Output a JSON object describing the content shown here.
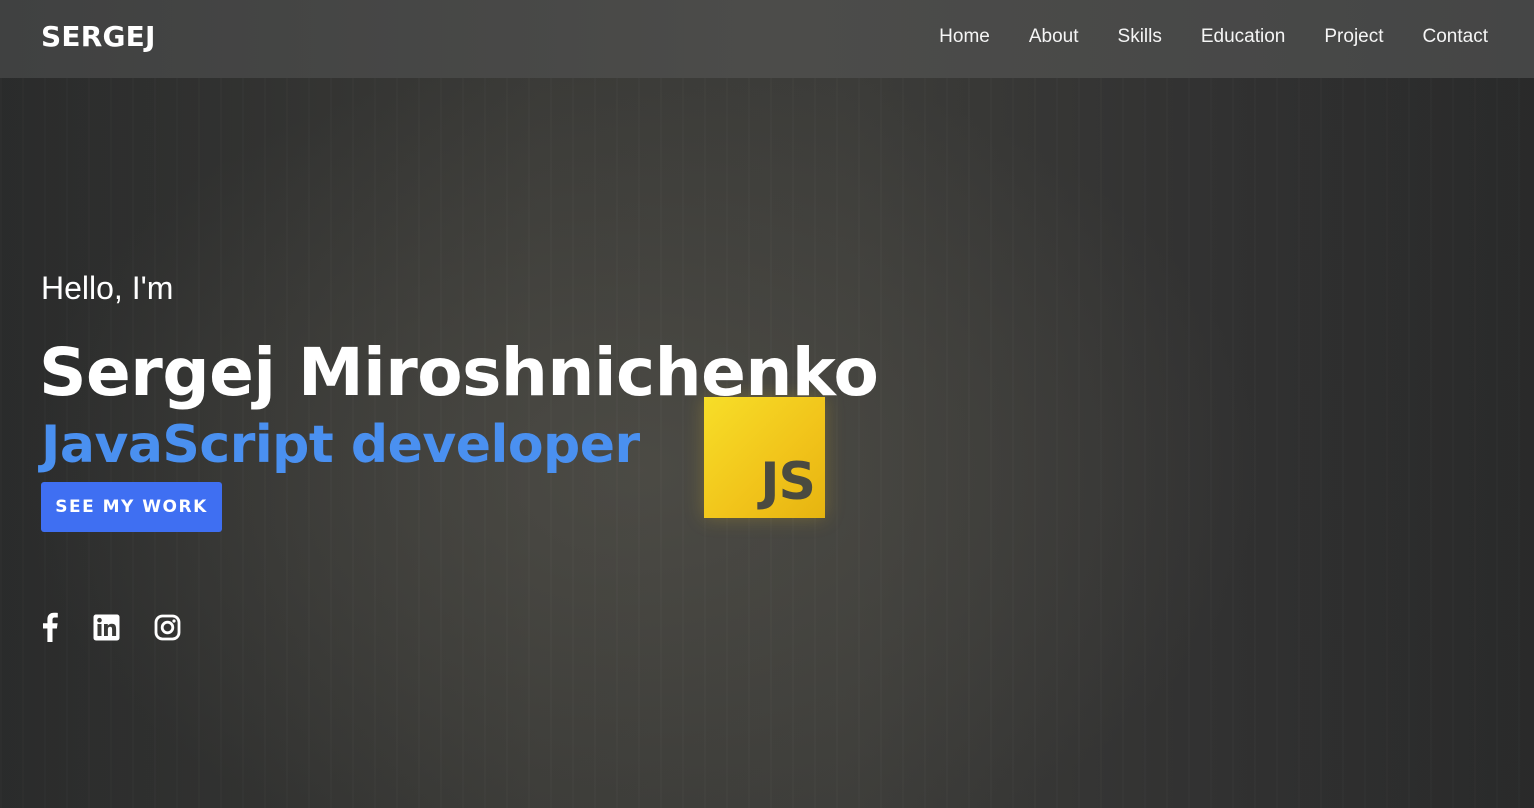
{
  "header": {
    "brand": "SERGEJ",
    "nav": [
      "Home",
      "About",
      "Skills",
      "Education",
      "Project",
      "Contact"
    ]
  },
  "hero": {
    "greeting": "Hello, I'm",
    "name": "Sergej Miroshnichenko",
    "role": "JavaScript developer",
    "cta_label": "SEE MY WORK",
    "badge_text": "JS"
  },
  "socials": [
    "facebook-icon",
    "linkedin-icon",
    "instagram-icon"
  ],
  "colors": {
    "accent": "#4a90f0",
    "button": "#3f6ff2",
    "js_yellow": "#f1c31a"
  }
}
